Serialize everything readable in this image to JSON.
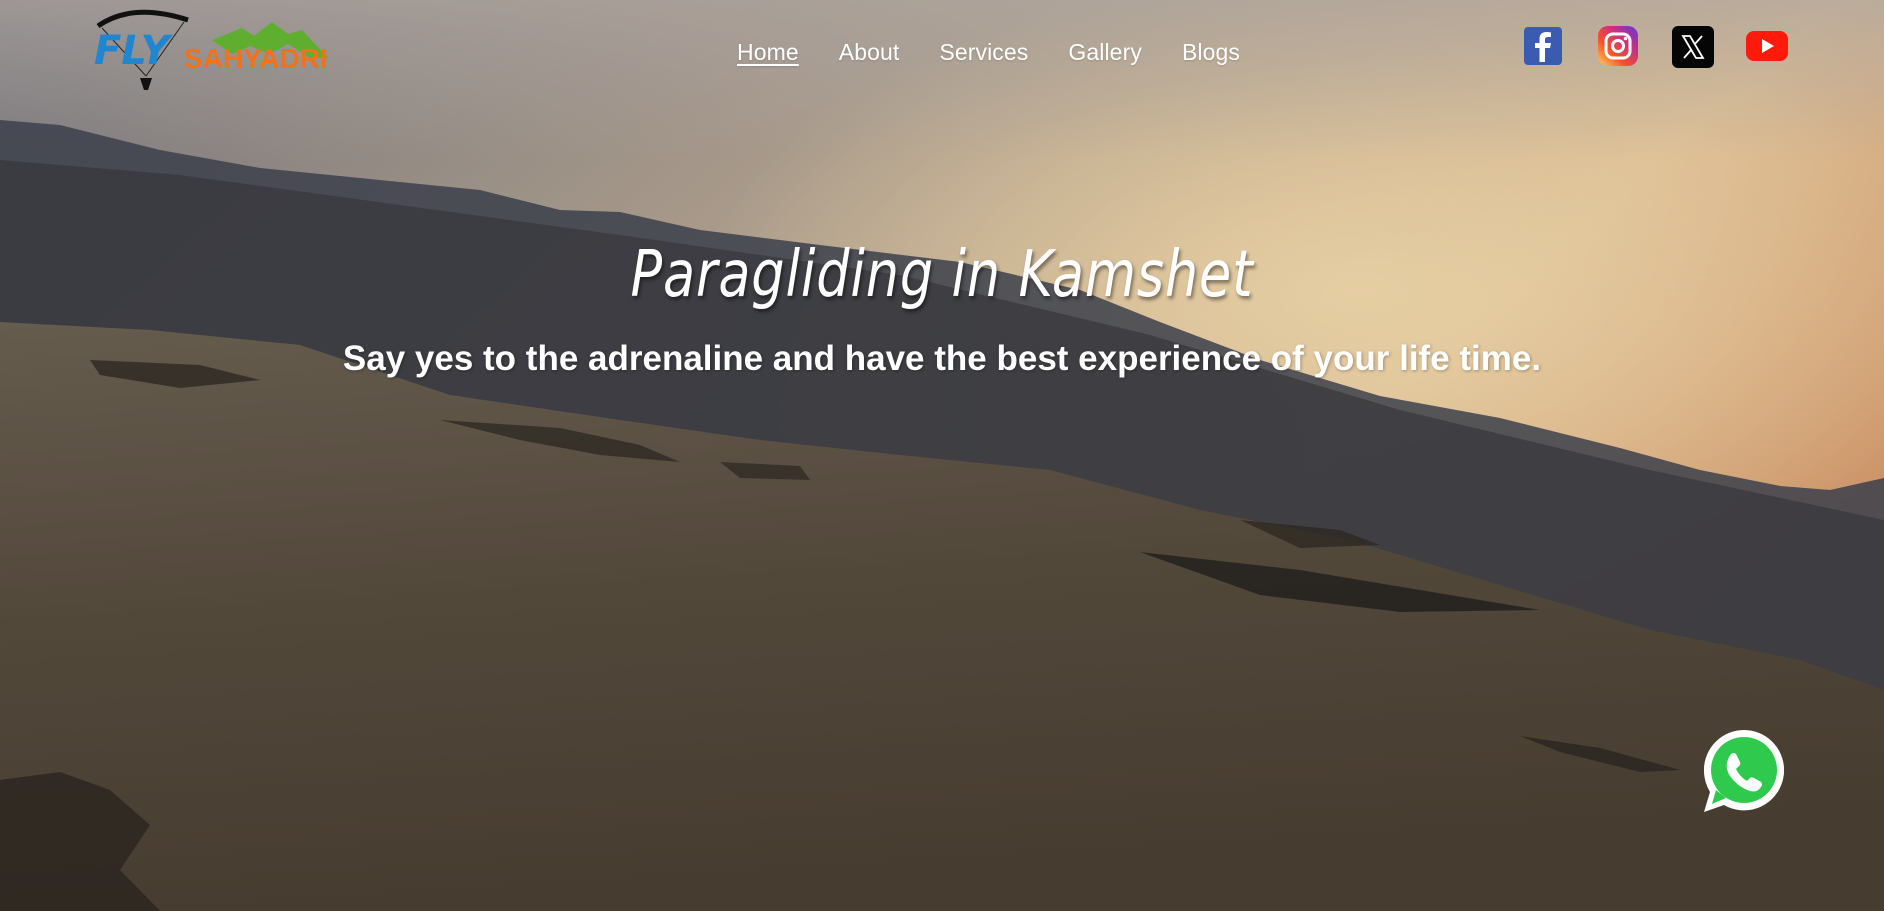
{
  "brand": {
    "logo_text_fly": "FLY",
    "logo_text_sahyadri": "SAHYADRI",
    "colors": {
      "fly": "#1f86cf",
      "sahyadri": "#f0721c",
      "mountain": "#5fae2f"
    }
  },
  "nav": {
    "items": [
      {
        "label": "Home",
        "active": true
      },
      {
        "label": "About",
        "active": false
      },
      {
        "label": "Services",
        "active": false
      },
      {
        "label": "Gallery",
        "active": false
      },
      {
        "label": "Blogs",
        "active": false
      }
    ]
  },
  "social": [
    {
      "icon": "facebook-icon",
      "color": "#3b5998"
    },
    {
      "icon": "instagram-icon",
      "color": "#c13584"
    },
    {
      "icon": "x-twitter-icon",
      "color": "#000000"
    },
    {
      "icon": "youtube-icon",
      "color": "#ff0000"
    }
  ],
  "hero": {
    "title": "Paragliding in Kamshet",
    "subtitle": "Say yes to the adrenaline and have the best experience of your life time."
  },
  "whatsapp": {
    "icon": "whatsapp-icon",
    "color": "#25d366"
  }
}
